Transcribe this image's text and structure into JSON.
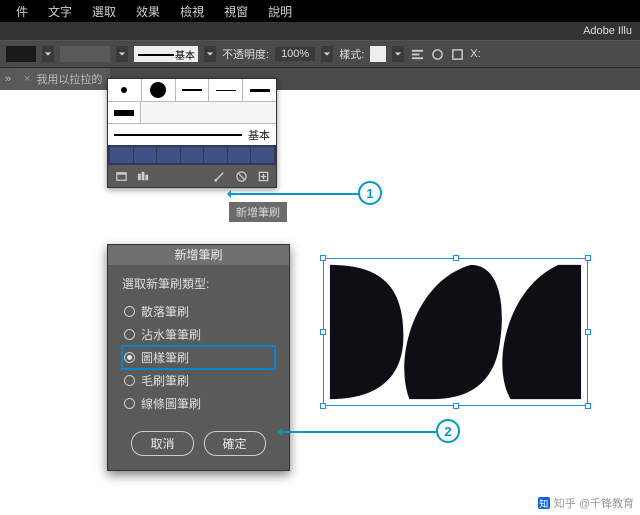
{
  "menubar": {
    "items": [
      "件",
      "文字",
      "選取",
      "效果",
      "檢視",
      "視窗",
      "說明"
    ]
  },
  "app_title": "Adobe Illu",
  "controlbar": {
    "stroke_preset_label": "基本",
    "opacity_label": "不透明度:",
    "opacity_value": "100%",
    "style_label": "樣式:",
    "x_label": "X:"
  },
  "doctab": {
    "title": "我用以拉拉的",
    "close_glyph": "×",
    "grip_glyph": "»"
  },
  "brushes_panel": {
    "basic_row_label": "基本",
    "tooltip": "新增筆刷",
    "footer_icons": [
      "brush-lib-icon",
      "libraries-icon",
      "stroke-options-icon",
      "delete-brush-icon",
      "new-brush-icon"
    ]
  },
  "dialog": {
    "title": "新增筆刷",
    "prompt": "選取新筆刷類型:",
    "options": [
      {
        "key": "scatter",
        "label": "散落筆刷",
        "selected": false
      },
      {
        "key": "calligraphic",
        "label": "沾水筆筆刷",
        "selected": false
      },
      {
        "key": "pattern",
        "label": "圖樣筆刷",
        "selected": true
      },
      {
        "key": "bristle",
        "label": "毛刷筆刷",
        "selected": false
      },
      {
        "key": "art",
        "label": "線條圖筆刷",
        "selected": false
      }
    ],
    "cancel_label": "取消",
    "ok_label": "確定"
  },
  "annotations": {
    "step1": "1",
    "step2": "2"
  },
  "watermark": {
    "logo_text": "知",
    "text": "知乎 @千锋教育"
  }
}
